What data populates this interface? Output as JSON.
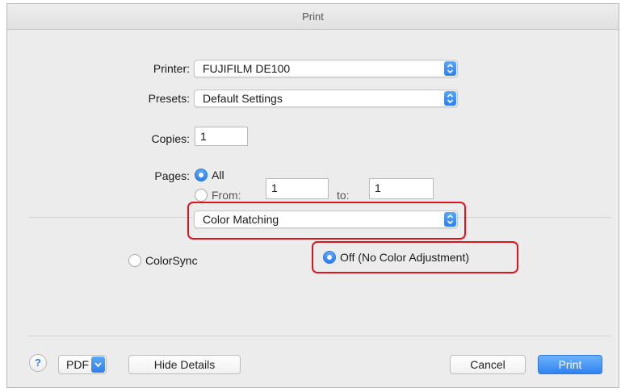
{
  "window": {
    "title": "Print"
  },
  "printer": {
    "label": "Printer:",
    "value": "FUJIFILM DE100"
  },
  "presets": {
    "label": "Presets:",
    "value": "Default Settings"
  },
  "copies": {
    "label": "Copies:",
    "value": "1"
  },
  "pages": {
    "label": "Pages:",
    "all_label": "All",
    "all_selected": true,
    "from_label": "From:",
    "from_value": "1",
    "to_label": "to:",
    "to_value": "1"
  },
  "section_popup": {
    "value": "Color Matching"
  },
  "color_options": [
    {
      "label": "ColorSync",
      "selected": false
    },
    {
      "label": "Off (No Color Adjustment)",
      "selected": true
    }
  ],
  "footer": {
    "help_glyph": "?",
    "pdf_label": "PDF",
    "hide_details_label": "Hide Details",
    "cancel_label": "Cancel",
    "print_label": "Print"
  },
  "colors": {
    "accent": "#2f82f1",
    "highlight": "#d9161d"
  }
}
